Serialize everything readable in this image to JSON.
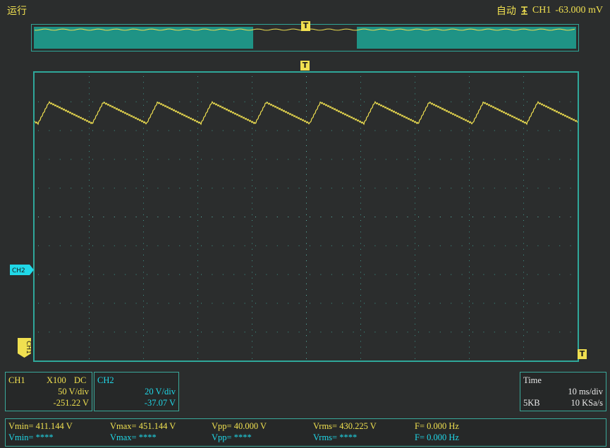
{
  "status": {
    "run_state": "运行",
    "trigger_mode": "自动",
    "trigger_channel": "CH1",
    "trigger_level": "-63.000 mV"
  },
  "markers": {
    "trigger_T": "T",
    "ch2": "CH2",
    "ch1": "CH1"
  },
  "ch1_panel": {
    "name": "CH1",
    "probe": "X100",
    "coupling": "DC",
    "volts_div": "50 V/div",
    "offset": "-251.22 V"
  },
  "ch2_panel": {
    "name": "CH2",
    "volts_div": "20 V/div",
    "offset": "-37.07 V"
  },
  "time_panel": {
    "label": "Time",
    "time_div": "10 ms/div",
    "depth": "5KB",
    "sample_rate": "10 KSa/s"
  },
  "measurements": {
    "ch1": {
      "vmin": "Vmin= 411.144 V",
      "vmax": "Vmax= 451.144 V",
      "vpp": "Vpp= 40.000 V",
      "vrms": "Vrms= 430.225 V",
      "freq": "F= 0.000 Hz"
    },
    "ch2": {
      "vmin": "Vmin= ****",
      "vmax": "Vmax= ****",
      "vpp": "Vpp= ****",
      "vrms": "Vrms= ****",
      "freq": "F= 0.000 Hz"
    }
  },
  "colors": {
    "ch1": "#f0e050",
    "ch2": "#20d8e8",
    "grid": "#2fa79a",
    "background": "#2b2d2d"
  }
}
